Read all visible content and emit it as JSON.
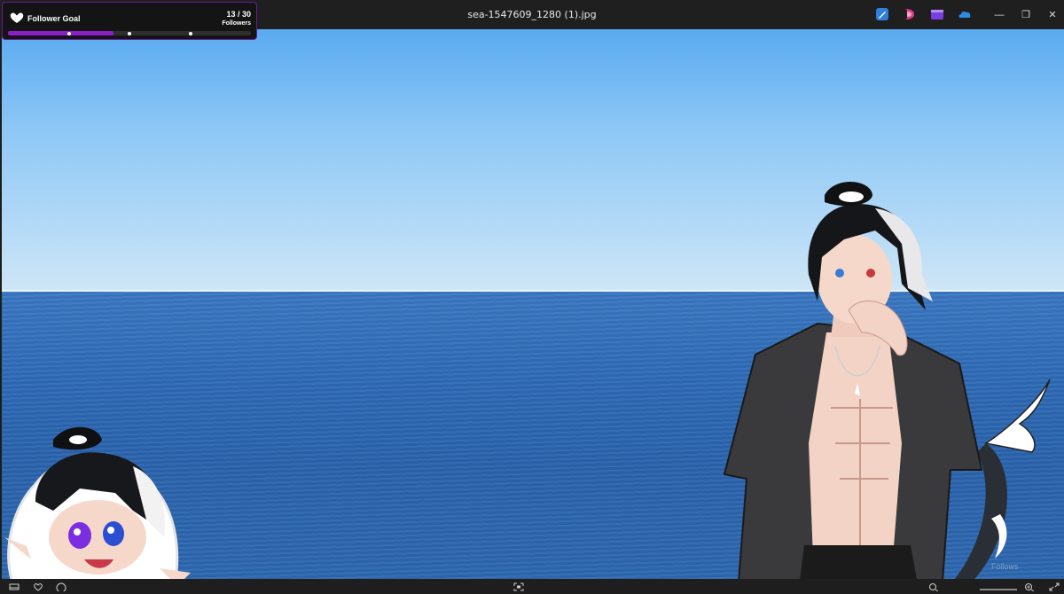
{
  "window": {
    "title": "sea-1547609_1280 (1).jpg",
    "minimize_label": "—",
    "maximize_label": "❐",
    "close_label": "✕"
  },
  "widget": {
    "title": "Follower Goal",
    "count": "13 / 30",
    "unit": "Followers",
    "progress": {
      "current": 13,
      "goal": 30
    },
    "milestone_fractions": [
      0.25,
      0.5,
      0.75
    ],
    "accent_color": "#8a1fc8"
  },
  "taskbar_icons": [
    "pen-app-icon",
    "copilot-icon",
    "clipchamp-icon",
    "onedrive-icon"
  ],
  "statusbar_icons": [
    "filmstrip-icon",
    "heart-icon",
    "info-icon",
    "fit-to-window-icon",
    "zoom-out-icon",
    "zoom-in-icon",
    "fullscreen-icon"
  ],
  "watermark": "Follows"
}
